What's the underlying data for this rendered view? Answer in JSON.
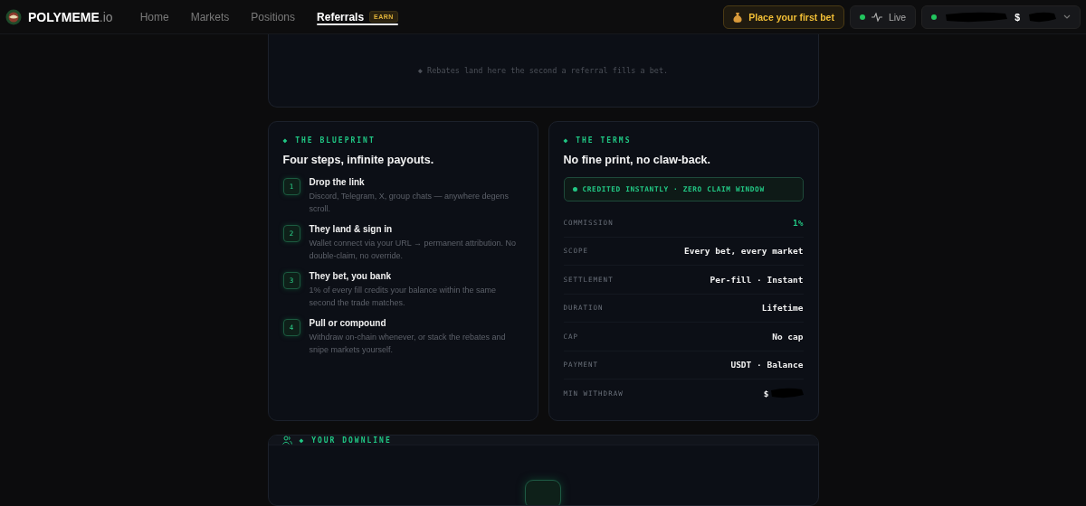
{
  "header": {
    "brand": {
      "name": "POLYMEME",
      "suffix": ".io"
    },
    "nav": [
      {
        "label": "Home",
        "selected": false
      },
      {
        "label": "Markets",
        "selected": false
      },
      {
        "label": "Positions",
        "selected": false
      },
      {
        "label": "Referrals",
        "selected": true,
        "badge": "EARN"
      }
    ],
    "cta": {
      "label": "Place your first bet"
    },
    "live": {
      "label": "Live",
      "on": true
    },
    "account": {
      "currency": "$",
      "online": true
    }
  },
  "rebates_card": {
    "message": "◆ Rebates land here the second a referral fills a bet."
  },
  "blueprint": {
    "eyebrow": "◆ THE BLUEPRINT",
    "title": "Four steps, infinite payouts.",
    "steps": [
      {
        "number": "1",
        "title": "Drop the link",
        "text": "Discord, Telegram, X, group chats — anywhere degens scroll."
      },
      {
        "number": "2",
        "title": "They land & sign in",
        "text": "Wallet connect via your URL → permanent attribution. No double-claim, no override."
      },
      {
        "number": "3",
        "title": "They bet, you bank",
        "text": "1% of every fill credits your balance within the same second the trade matches."
      },
      {
        "number": "4",
        "title": "Pull or compound",
        "text": "Withdraw on-chain whenever, or stack the rebates and snipe markets yourself."
      }
    ]
  },
  "terms": {
    "eyebrow": "◆ THE TERMS",
    "title": "No fine print, no claw-back.",
    "banner": "CREDITED INSTANTLY · ZERO CLAIM WINDOW",
    "rows": [
      {
        "label": "COMMISSION",
        "value": "1%",
        "accent": true,
        "redacted": false
      },
      {
        "label": "SCOPE",
        "value": "Every bet, every market",
        "accent": false,
        "redacted": false
      },
      {
        "label": "SETTLEMENT",
        "value": "Per-fill · Instant",
        "accent": false,
        "redacted": false
      },
      {
        "label": "DURATION",
        "value": "Lifetime",
        "accent": false,
        "redacted": false
      },
      {
        "label": "CAP",
        "value": "No cap",
        "accent": false,
        "redacted": false
      },
      {
        "label": "PAYMENT",
        "value": "USDT · Balance",
        "accent": false,
        "redacted": false
      },
      {
        "label": "MIN WITHDRAW",
        "value": "$",
        "accent": false,
        "redacted": true
      }
    ]
  },
  "downline": {
    "eyebrow": "◆ YOUR DOWNLINE"
  }
}
